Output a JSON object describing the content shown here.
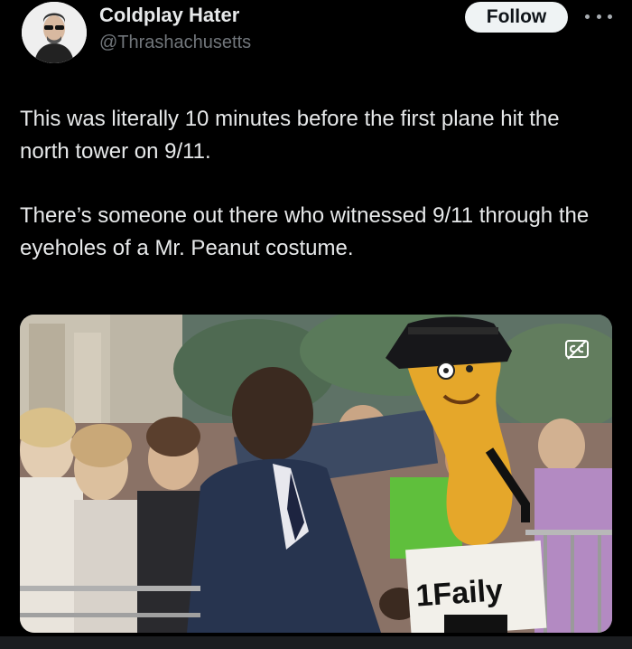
{
  "author": {
    "display_name": "Coldplay Hater",
    "handle": "@Thrashachusetts"
  },
  "follow_button": {
    "label": "Follow"
  },
  "more_icon": "more-horizontal-icon",
  "tweet": {
    "paragraphs": [
      "This was literally 10 minutes before the first plane hit the north tower on 9/11.",
      "There’s someone out there who witnessed 9/11 through the eyeholes of a Mr. Peanut costume."
    ]
  },
  "media": {
    "kind": "video",
    "sign_text": "1Faily",
    "caption_icon": "closed-captions-icon"
  },
  "colors": {
    "background": "#000000",
    "text_primary": "#e7e9ea",
    "text_secondary": "#71767b",
    "follow_bg": "#eff3f4",
    "peanut": "#e5a72a"
  }
}
